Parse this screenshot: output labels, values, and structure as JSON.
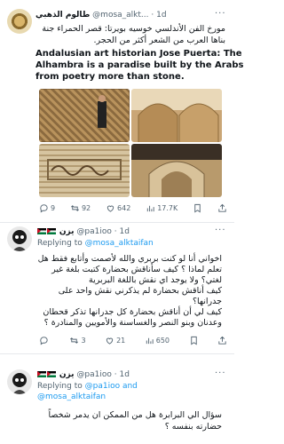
{
  "tweet1": {
    "display_name": "طالوم الذهبي",
    "handle": "@mosa_alkt...",
    "dot": "·",
    "time": "1d",
    "more": "···",
    "text_ar_1": "مورخ الفن الأندلسي خوسيه بويرتا: قصر الحمراء جنة",
    "text_ar_2": "بناها العرب من الشعر أكثر من الحجر.",
    "text_en_1": "Andalusian art historian Jose Puerta: The",
    "text_en_2": "Alhambra is a paradise built by the Arabs",
    "text_en_3": "from poetry more than stone.",
    "stats": {
      "replies": "9",
      "retweets": "92",
      "likes": "642",
      "views": "17.7K"
    }
  },
  "tweet2": {
    "display_name": "يزن",
    "handle": "@pa1ioo",
    "dot": "·",
    "time": "1d",
    "more": "···",
    "replying_prefix": "Replying to",
    "replying_to": "@mosa_alktaifan",
    "lines": [
      "اخواني أنا لو كنت بربري والله لأصمت وأتابع فقط هل",
      "تعلم لماذا ؟ كيف سأناقش بحضارة كتبت بلغة غير",
      "لغتي؟ ولا يوجد اي نقش باللغة البربرية",
      "كيف أناقش بحضارة لم يذكرني نقش واحد على",
      "جدرانها؟",
      "كيف لي أن أناقش بحضارة كل جدرانها تذكر قحطان",
      "وعدنان وبنو النصر والغساسنة والأمويين والمنادرة ؟"
    ],
    "stats": {
      "replies": "",
      "retweets": "3",
      "likes": "21",
      "views": "650"
    }
  },
  "tweet3": {
    "display_name": "يزن",
    "handle": "@pa1ioo",
    "dot": "·",
    "time": "1d",
    "more": "···",
    "replying_prefix": "Replying to",
    "replying_to_1": "@pa1ioo and",
    "replying_to_2": "@mosa_alktaifan",
    "lines": [
      "سؤال الي البرابرة هل من الممكن ان يدمر شخصاً",
      "حضارته بنفسه ؟"
    ]
  }
}
